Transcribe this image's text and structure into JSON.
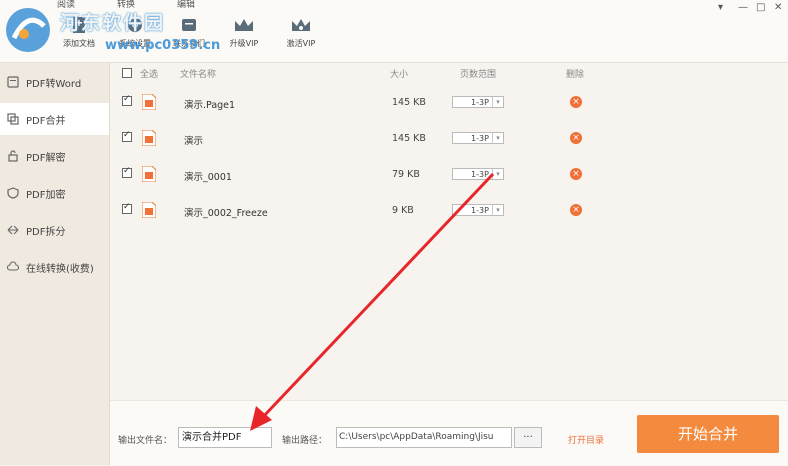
{
  "menu": {
    "tabs": [
      "阅读",
      "转换",
      "编辑"
    ]
  },
  "toolbar": {
    "items": [
      {
        "label": "添加文档",
        "icon": "add-document-icon"
      },
      {
        "label": "系统设置",
        "icon": "settings-icon"
      },
      {
        "label": "联系我们",
        "icon": "contact-icon"
      },
      {
        "label": "升级VIP",
        "icon": "crown-icon"
      },
      {
        "label": "激活VIP",
        "icon": "activate-crown-icon"
      }
    ]
  },
  "watermark": {
    "text": "河东软件园",
    "url": "www.pc0359.cn"
  },
  "window": {
    "minimize": "—",
    "maximize": "□",
    "close": "✕",
    "menu": "▾"
  },
  "sidebar": {
    "items": [
      {
        "label": "PDF转Word",
        "icon": "pdf-word-icon"
      },
      {
        "label": "PDF合并",
        "icon": "merge-icon",
        "active": true
      },
      {
        "label": "PDF解密",
        "icon": "unlock-icon"
      },
      {
        "label": "PDF加密",
        "icon": "shield-icon"
      },
      {
        "label": "PDF拆分",
        "icon": "split-icon"
      },
      {
        "label": "在线转换(收费)",
        "icon": "cloud-icon"
      }
    ]
  },
  "table": {
    "headers": {
      "select_all": "全选",
      "file_name": "文件名称",
      "size": "大小",
      "page_range": "页数范围",
      "delete": "删除"
    },
    "rows": [
      {
        "name": "演示.Page1",
        "size": "145 KB",
        "range": "1-3P",
        "checked": true
      },
      {
        "name": "演示",
        "size": "145 KB",
        "range": "1-3P",
        "checked": true
      },
      {
        "name": "演示_0001",
        "size": "79 KB",
        "range": "1-3P",
        "checked": true
      },
      {
        "name": "演示_0002_Freeze",
        "size": "9 KB",
        "range": "1-3P",
        "checked": true
      }
    ]
  },
  "bottom": {
    "output_name_label": "输出文件名：",
    "output_name_value": "演示合并PDF",
    "output_path_label": "输出路径：",
    "output_path_value": "C:\\Users\\pc\\AppData\\Roaming\\Jisu",
    "browse_label": "···",
    "open_dir_label": "打开目录",
    "start_label": "开始合并"
  },
  "colors": {
    "accent": "#f38a3d",
    "delete": "#f07038",
    "annotation_arrow": "#e8262a"
  }
}
